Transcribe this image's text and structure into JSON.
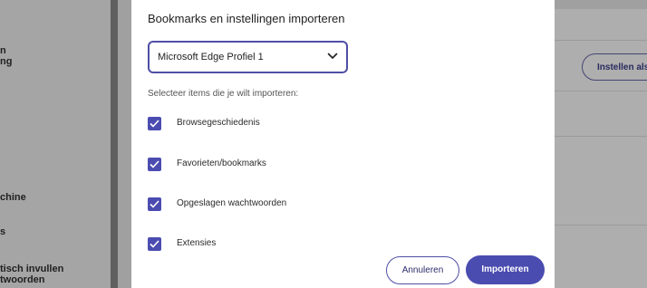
{
  "background": {
    "sidebar_items": [
      "n\nng",
      "chine",
      "s",
      "tisch invullen\ntwoorden"
    ],
    "action_button_label": "Instellen als"
  },
  "dialog": {
    "title": "Bookmarks en instellingen importeren",
    "profile_select": {
      "value": "Microsoft Edge Profiel 1",
      "icon": "chevron-down-icon"
    },
    "instruction": "Selecteer items die je wilt importeren:",
    "options": [
      {
        "label": "Browsegeschiedenis",
        "checked": true
      },
      {
        "label": "Favorieten/bookmarks",
        "checked": true
      },
      {
        "label": "Opgeslagen wachtwoorden",
        "checked": true
      },
      {
        "label": "Extensies",
        "checked": true
      }
    ],
    "cancel_label": "Annuleren",
    "import_label": "Importeren"
  },
  "colors": {
    "accent": "#4b4cb0",
    "overlay": "#8e8e8e"
  }
}
